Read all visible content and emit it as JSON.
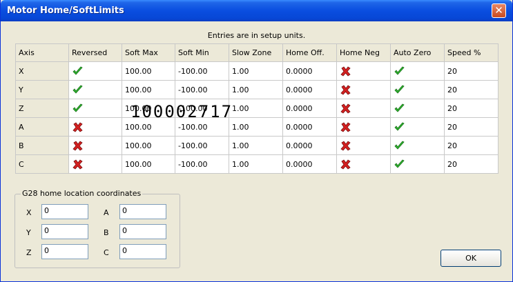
{
  "window": {
    "title": "Motor Home/SoftLimits",
    "close_label": "✕"
  },
  "caption": "Entries are in setup units.",
  "table": {
    "columns": [
      "Axis",
      "Reversed",
      "Soft Max",
      "Soft Min",
      "Slow Zone",
      "Home Off.",
      "Home Neg",
      "Auto Zero",
      "Speed %"
    ],
    "rows": [
      {
        "axis": "X",
        "reversed": true,
        "soft_max": "100.00",
        "soft_min": "-100.00",
        "slow_zone": "1.00",
        "home_off": "0.0000",
        "home_neg": false,
        "auto_zero": true,
        "speed": "20"
      },
      {
        "axis": "Y",
        "reversed": true,
        "soft_max": "100.00",
        "soft_min": "-100.00",
        "slow_zone": "1.00",
        "home_off": "0.0000",
        "home_neg": false,
        "auto_zero": true,
        "speed": "20"
      },
      {
        "axis": "Z",
        "reversed": true,
        "soft_max": "100.00",
        "soft_min": "-100.00",
        "slow_zone": "1.00",
        "home_off": "0.0000",
        "home_neg": false,
        "auto_zero": true,
        "speed": "20"
      },
      {
        "axis": "A",
        "reversed": false,
        "soft_max": "100.00",
        "soft_min": "-100.00",
        "slow_zone": "1.00",
        "home_off": "0.0000",
        "home_neg": false,
        "auto_zero": true,
        "speed": "20"
      },
      {
        "axis": "B",
        "reversed": false,
        "soft_max": "100.00",
        "soft_min": "-100.00",
        "slow_zone": "1.00",
        "home_off": "0.0000",
        "home_neg": false,
        "auto_zero": true,
        "speed": "20"
      },
      {
        "axis": "C",
        "reversed": false,
        "soft_max": "100.00",
        "soft_min": "-100.00",
        "slow_zone": "1.00",
        "home_off": "0.0000",
        "home_neg": false,
        "auto_zero": true,
        "speed": "20"
      }
    ]
  },
  "overlay_text": "100002717",
  "g28": {
    "title": "G28 home location coordinates",
    "fields": [
      {
        "label": "X",
        "value": "0"
      },
      {
        "label": "Y",
        "value": "0"
      },
      {
        "label": "Z",
        "value": "0"
      },
      {
        "label": "A",
        "value": "0"
      },
      {
        "label": "B",
        "value": "0"
      },
      {
        "label": "C",
        "value": "0"
      }
    ]
  },
  "ok_label": "OK",
  "icons": {
    "check": "green-check-icon",
    "cross": "red-x-icon"
  },
  "colors": {
    "check": "#2eb82e",
    "cross": "#d42020",
    "title_bar": "#0a4ee0"
  }
}
